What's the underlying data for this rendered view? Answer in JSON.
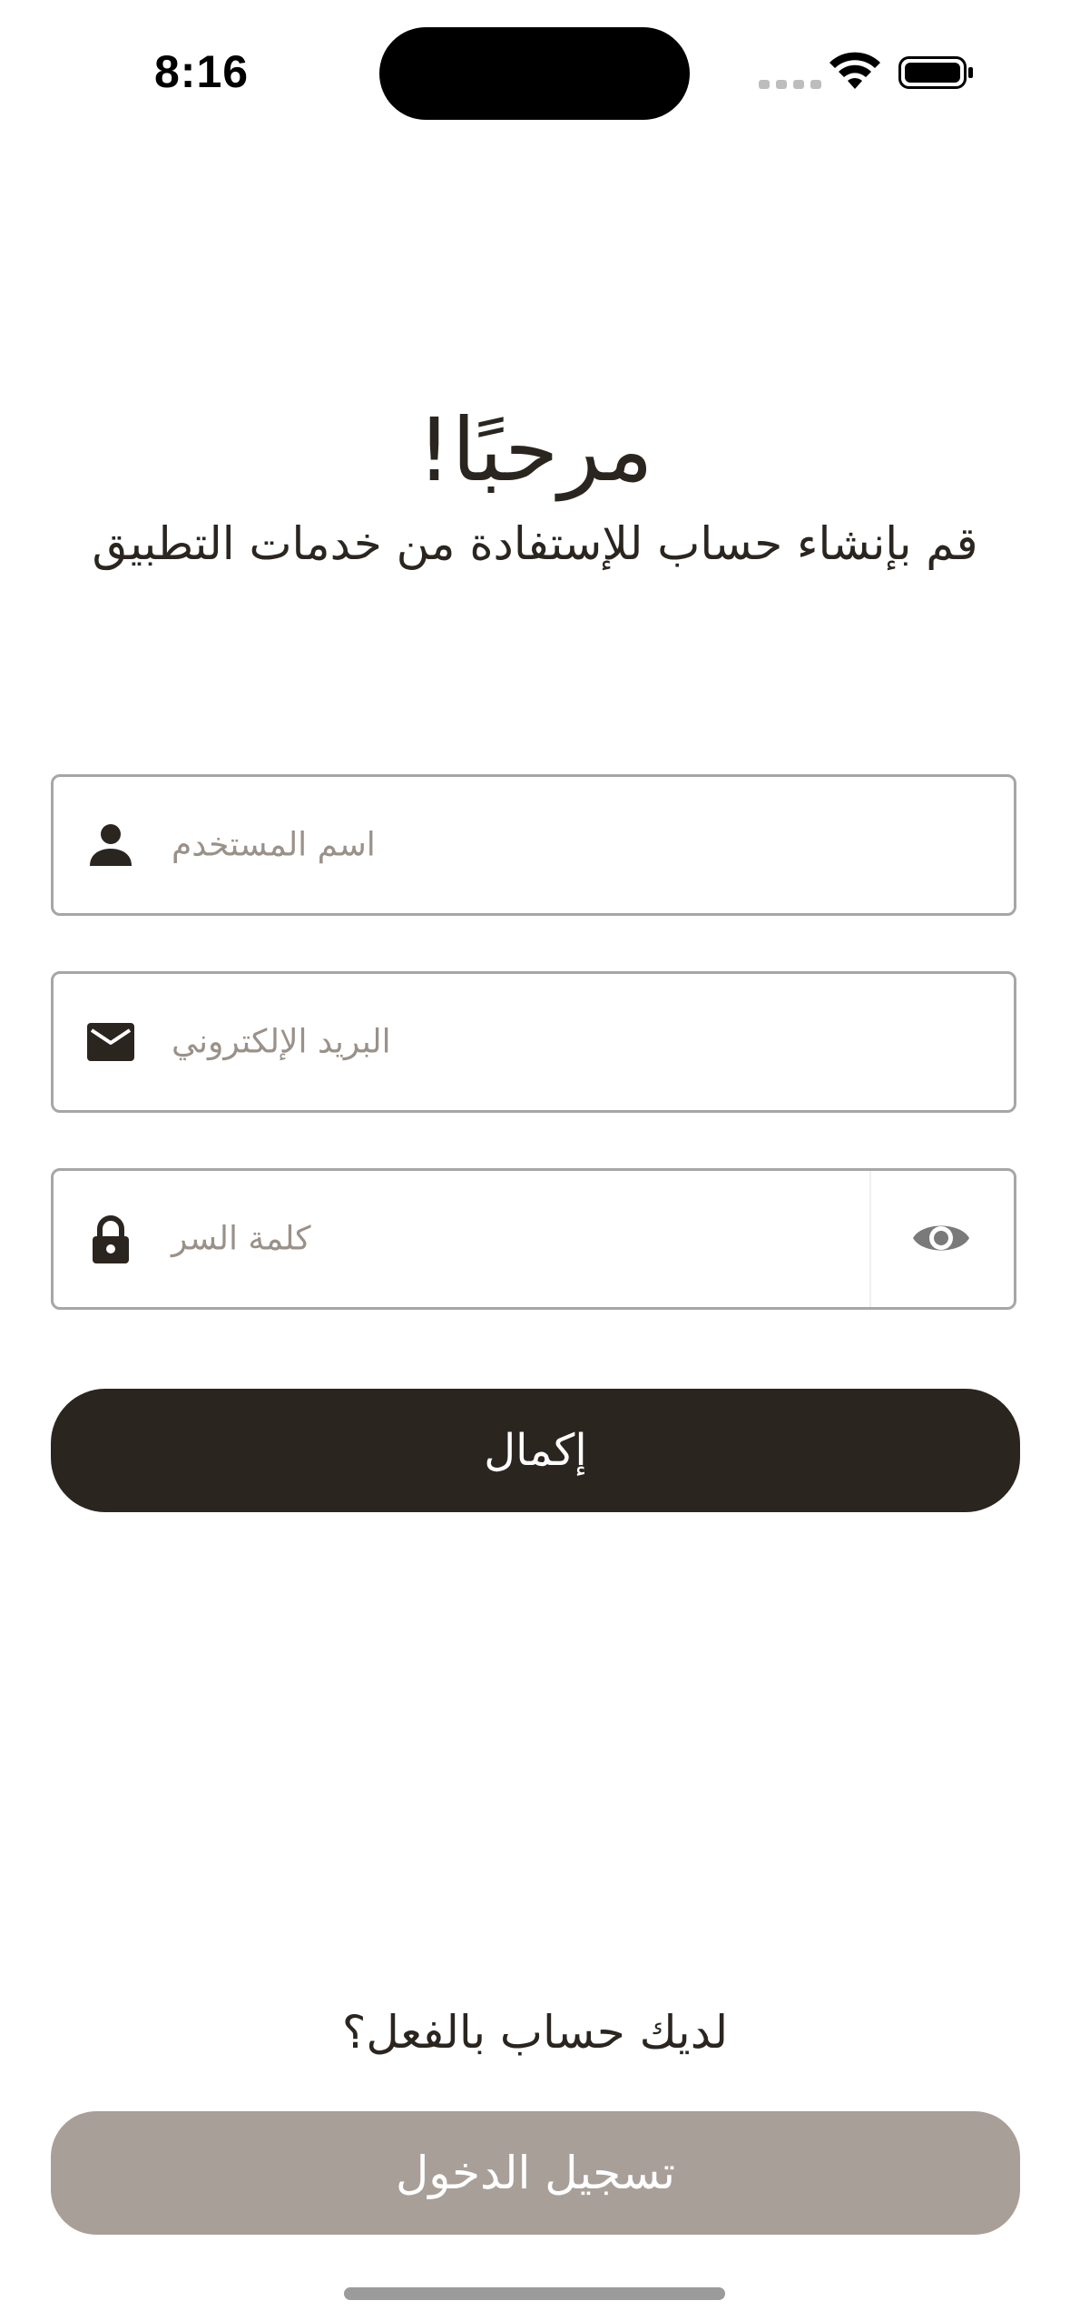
{
  "status_bar": {
    "time": "8:16"
  },
  "header": {
    "title": "مرحبًا!",
    "subtitle": "قم بإنشاء حساب للإستفادة من خدمات التطبيق"
  },
  "form": {
    "username": {
      "placeholder": "اسم المستخدم",
      "icon": "person-icon",
      "value": ""
    },
    "email": {
      "placeholder": "البريد الإلكتروني",
      "icon": "mail-icon",
      "value": ""
    },
    "password": {
      "placeholder": "كلمة السر",
      "icon": "lock-icon",
      "toggle_icon": "eye-icon",
      "value": ""
    },
    "submit_label": "إكمال"
  },
  "footer": {
    "prompt": "لديك حساب بالفعل؟",
    "login_label": "تسجيل الدخول"
  },
  "colors": {
    "primary": "#2b2520",
    "secondary_button": "#a89f98",
    "placeholder": "#9a9189",
    "field_border": "#a6a6a6"
  }
}
